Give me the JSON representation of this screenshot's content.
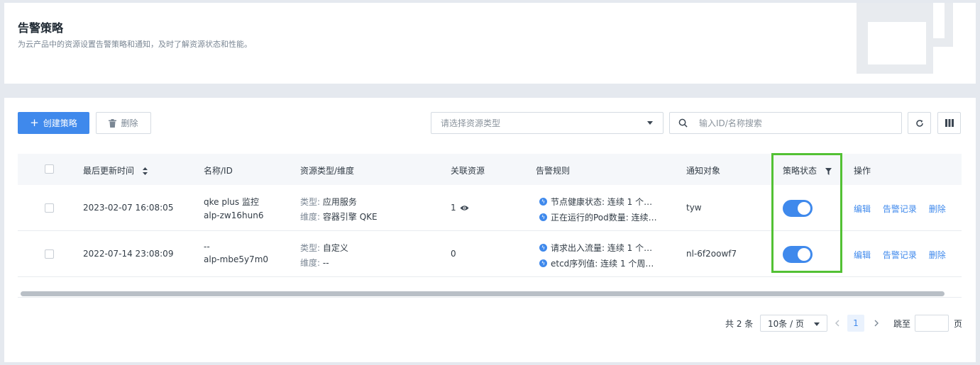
{
  "header": {
    "title": "告警策略",
    "description": "为云产品中的资源设置告警策略和通知，及时了解资源状态和性能。"
  },
  "toolbar": {
    "create_label": "创建策略",
    "delete_label": "删除",
    "resource_type_placeholder": "请选择资源类型",
    "search_placeholder": "输入ID/名称搜索"
  },
  "table": {
    "columns": {
      "updated": "最后更新时间",
      "name": "名称/ID",
      "resource": "资源类型/维度",
      "linked": "关联资源",
      "rules": "告警规则",
      "notify": "通知对象",
      "status": "策略状态",
      "actions": "操作"
    },
    "rows": [
      {
        "updated": "2023-02-07 16:08:05",
        "name": "qke plus 监控",
        "id": "alp-zw16hun6",
        "type_label": "类型:",
        "type_value": "应用服务",
        "dim_label": "维度:",
        "dim_value": "容器引擎 QKE",
        "linked": "1",
        "rule1": "节点健康状态: 连续 1 个…",
        "rule2": "正在运行的Pod数量: 连续…",
        "notify": "tyw",
        "enabled": true,
        "edit": "编辑",
        "history": "告警记录",
        "delete": "删除"
      },
      {
        "updated": "2022-07-14 23:08:09",
        "name": "--",
        "id": "alp-mbe5y7m0",
        "type_label": "类型:",
        "type_value": "自定义",
        "dim_label": "维度:",
        "dim_value": "--",
        "linked": "0",
        "rule1": "请求出入流量: 连续 1 个…",
        "rule2": "etcd序列值: 连续 1 个周…",
        "notify": "nl-6f2oowf7",
        "enabled": true,
        "edit": "编辑",
        "history": "告警记录",
        "delete": "删除"
      }
    ]
  },
  "pagination": {
    "total": "共 2 条",
    "page_size": "10条 / 页",
    "current_page": "1",
    "jump_label": "跳至",
    "jump_suffix": "页"
  },
  "colors": {
    "primary": "#3f89ec",
    "highlight": "#53c134"
  }
}
